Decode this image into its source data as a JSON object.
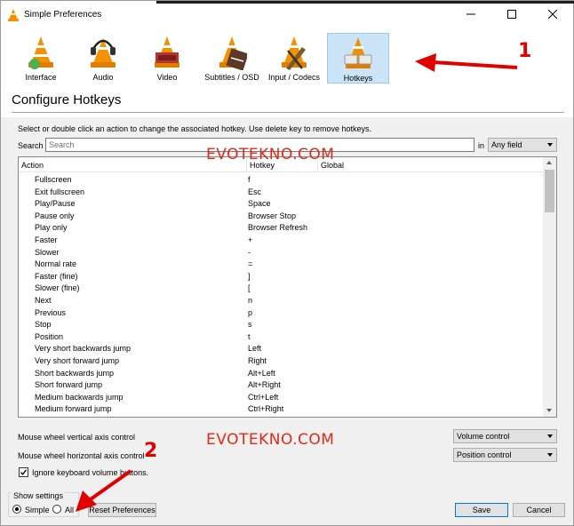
{
  "window": {
    "title": "Simple Preferences",
    "icon": "vlc-cone-icon"
  },
  "categories": [
    {
      "label": "Interface",
      "icon": "interface-cone-icon",
      "active": false
    },
    {
      "label": "Audio",
      "icon": "audio-cone-icon",
      "active": false
    },
    {
      "label": "Video",
      "icon": "video-cone-icon",
      "active": false
    },
    {
      "label": "Subtitles / OSD",
      "icon": "subtitles-cone-icon",
      "active": false
    },
    {
      "label": "Input / Codecs",
      "icon": "input-cone-icon",
      "active": false
    },
    {
      "label": "Hotkeys",
      "icon": "hotkeys-cone-icon",
      "active": true
    }
  ],
  "page": {
    "heading": "Configure Hotkeys",
    "description": "Select or double click an action to change the associated hotkey. Use delete key to remove hotkeys."
  },
  "search": {
    "label": "Search",
    "placeholder": "Search",
    "value": "",
    "in_label": "in",
    "scope": "Any field"
  },
  "table": {
    "columns": {
      "action": "Action",
      "hotkey": "Hotkey",
      "global": "Global"
    },
    "rows": [
      {
        "action": "Fullscreen",
        "hotkey": "f"
      },
      {
        "action": "Exit fullscreen",
        "hotkey": "Esc"
      },
      {
        "action": "Play/Pause",
        "hotkey": "Space"
      },
      {
        "action": "Pause only",
        "hotkey": "Browser Stop"
      },
      {
        "action": "Play only",
        "hotkey": "Browser Refresh"
      },
      {
        "action": "Faster",
        "hotkey": "+"
      },
      {
        "action": "Slower",
        "hotkey": "-"
      },
      {
        "action": "Normal rate",
        "hotkey": "="
      },
      {
        "action": "Faster (fine)",
        "hotkey": "]"
      },
      {
        "action": "Slower (fine)",
        "hotkey": "["
      },
      {
        "action": "Next",
        "hotkey": "n"
      },
      {
        "action": "Previous",
        "hotkey": "p"
      },
      {
        "action": "Stop",
        "hotkey": "s"
      },
      {
        "action": "Position",
        "hotkey": "t"
      },
      {
        "action": "Very short backwards jump",
        "hotkey": "Left"
      },
      {
        "action": "Very short forward jump",
        "hotkey": "Right"
      },
      {
        "action": "Short backwards jump",
        "hotkey": "Alt+Left"
      },
      {
        "action": "Short forward jump",
        "hotkey": "Alt+Right"
      },
      {
        "action": "Medium backwards jump",
        "hotkey": "Ctrl+Left"
      },
      {
        "action": "Medium forward jump",
        "hotkey": "Ctrl+Right"
      }
    ]
  },
  "mouse": {
    "vertical_label": "Mouse wheel vertical axis control",
    "vertical_value": "Volume control",
    "horizontal_label": "Mouse wheel horizontal axis control",
    "horizontal_value": "Position control"
  },
  "ignore_volume": {
    "label": "Ignore keyboard volume buttons.",
    "checked": true
  },
  "show_settings": {
    "title": "Show settings",
    "simple": "Simple",
    "all": "All",
    "selected": "simple"
  },
  "buttons": {
    "reset": "Reset Preferences",
    "save": "Save",
    "cancel": "Cancel"
  },
  "watermark": "EVOTEKNO.COM",
  "annotations": {
    "one": "1",
    "two": "2"
  },
  "colors": {
    "accent": "#0078d7",
    "selected_bg": "#cce4f7",
    "annotation": "#e10000",
    "watermark": "#e02a18"
  }
}
